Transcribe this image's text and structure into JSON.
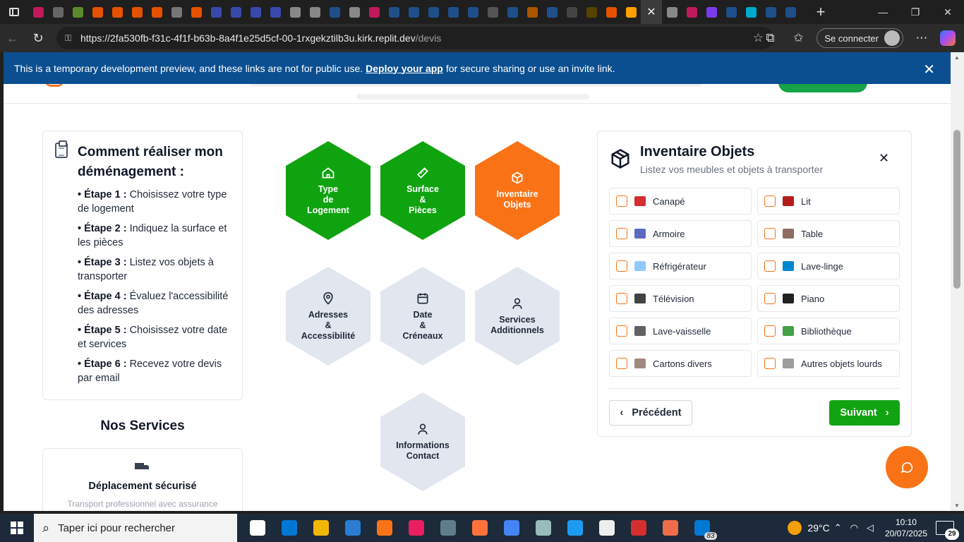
{
  "browser": {
    "tab_favicons": [
      "#c2185b",
      "#666",
      "#5a8a2b",
      "#e65100",
      "#e65100",
      "#e65100",
      "#e65100",
      "#777",
      "#e65100",
      "#3949ab",
      "#3949ab",
      "#3949ab",
      "#3949ab",
      "#888",
      "#888",
      "#1e4f8a",
      "#888",
      "#c2185b",
      "#1e4f8a",
      "#1e4f8a",
      "#1e4f8a",
      "#1e4f8a",
      "#1e4f8a",
      "#555",
      "#1e4f8a",
      "#aa5500",
      "#1e4f8a",
      "#444",
      "#554400",
      "#e65100",
      "#ffa000",
      "#888",
      "#c2185b",
      "#7c3aed",
      "#1e4f8a",
      "#00aacc",
      "#1e4f8a",
      "#1e4f8a"
    ],
    "active_tab_close": "✕",
    "new_tab": "+",
    "url_host": "https://2fa530fb-f31c-4f1f-b63b-8a4f1e25d5cf-00-1rxgekztilb3u.kirk.replit.dev",
    "url_path": "/devis",
    "signin_label": "Se connecter"
  },
  "banner": {
    "text_before": "This is a temporary development preview, and these links are not for public use.",
    "link": "Deploy your app",
    "text_after": "for secure sharing or use an invite link."
  },
  "guide": {
    "title": "Comment réaliser mon déménagement :",
    "steps": [
      {
        "label": "• Étape 1 :",
        "text": "Choisissez votre type de logement"
      },
      {
        "label": "• Étape 2 :",
        "text": "Indiquez la surface et les pièces"
      },
      {
        "label": "• Étape 3 :",
        "text": "Listez vos objets à transporter"
      },
      {
        "label": "• Étape 4 :",
        "text": "Évaluez l'accessibilité des adresses"
      },
      {
        "label": "• Étape 5 :",
        "text": "Choisissez votre date et services"
      },
      {
        "label": "• Étape 6 :",
        "text": "Recevez votre devis par email"
      }
    ]
  },
  "services": {
    "title": "Nos Services",
    "card_title": "Déplacement sécurisé",
    "card_text": "Transport professionnel avec assurance"
  },
  "steps_hex": [
    {
      "label": "Type\nde\nLogement",
      "state": "done",
      "icon": "home-icon"
    },
    {
      "label": "Surface\n&\nPièces",
      "state": "done",
      "icon": "ruler-icon"
    },
    {
      "label": "Inventaire\nObjets",
      "state": "active",
      "icon": "box-icon"
    },
    {
      "label": "Adresses\n&\nAccessibilité",
      "state": "todo",
      "icon": "map-pin-icon"
    },
    {
      "label": "Date\n&\nCréneaux",
      "state": "todo",
      "icon": "calendar-icon"
    },
    {
      "label": "Services\nAdditionnels",
      "state": "todo",
      "icon": "user-icon"
    },
    {
      "label": "Informations\nContact",
      "state": "todo",
      "icon": "user-icon"
    }
  ],
  "inventory": {
    "title": "Inventaire Objets",
    "subtitle": "Listez vos meubles et objets à transporter",
    "items": [
      {
        "label": "Canapé",
        "icon": "sofa-icon",
        "color": "#d32f2f"
      },
      {
        "label": "Lit",
        "icon": "bed-icon",
        "color": "#b71c1c"
      },
      {
        "label": "Armoire",
        "icon": "wardrobe-icon",
        "color": "#5c6bc0"
      },
      {
        "label": "Table",
        "icon": "table-icon",
        "color": "#8d6e63"
      },
      {
        "label": "Réfrigérateur",
        "icon": "fridge-icon",
        "color": "#90caf9"
      },
      {
        "label": "Lave-linge",
        "icon": "washing-machine-icon",
        "color": "#0288d1"
      },
      {
        "label": "Télévision",
        "icon": "tv-icon",
        "color": "#424242"
      },
      {
        "label": "Piano",
        "icon": "piano-icon",
        "color": "#212121"
      },
      {
        "label": "Lave-vaisselle",
        "icon": "dishwasher-icon",
        "color": "#616161"
      },
      {
        "label": "Bibliothèque",
        "icon": "bookshelf-icon",
        "color": "#43a047"
      },
      {
        "label": "Cartons divers",
        "icon": "cardboard-box-icon",
        "color": "#a1887f"
      },
      {
        "label": "Autres objets lourds",
        "icon": "clipboard-icon",
        "color": "#9e9e9e"
      }
    ],
    "prev_label": "Précédent",
    "next_label": "Suivant"
  },
  "taskbar": {
    "search_placeholder": "Taper ici pour rechercher",
    "apps": [
      "#ffffff",
      "#0078d4",
      "#f2b705",
      "#2b7cd3",
      "#f97316",
      "#e91e63",
      "#607d8b",
      "#ff7139",
      "#4285f4",
      "#9bb",
      "#1d9bf0",
      "#eeeeee",
      "#d32f2f",
      "#ef6c4a",
      "#0078d4"
    ],
    "badge_count": "83",
    "temperature": "29°C",
    "time": "10:10",
    "date": "20/07/2025",
    "notifications": "29"
  }
}
